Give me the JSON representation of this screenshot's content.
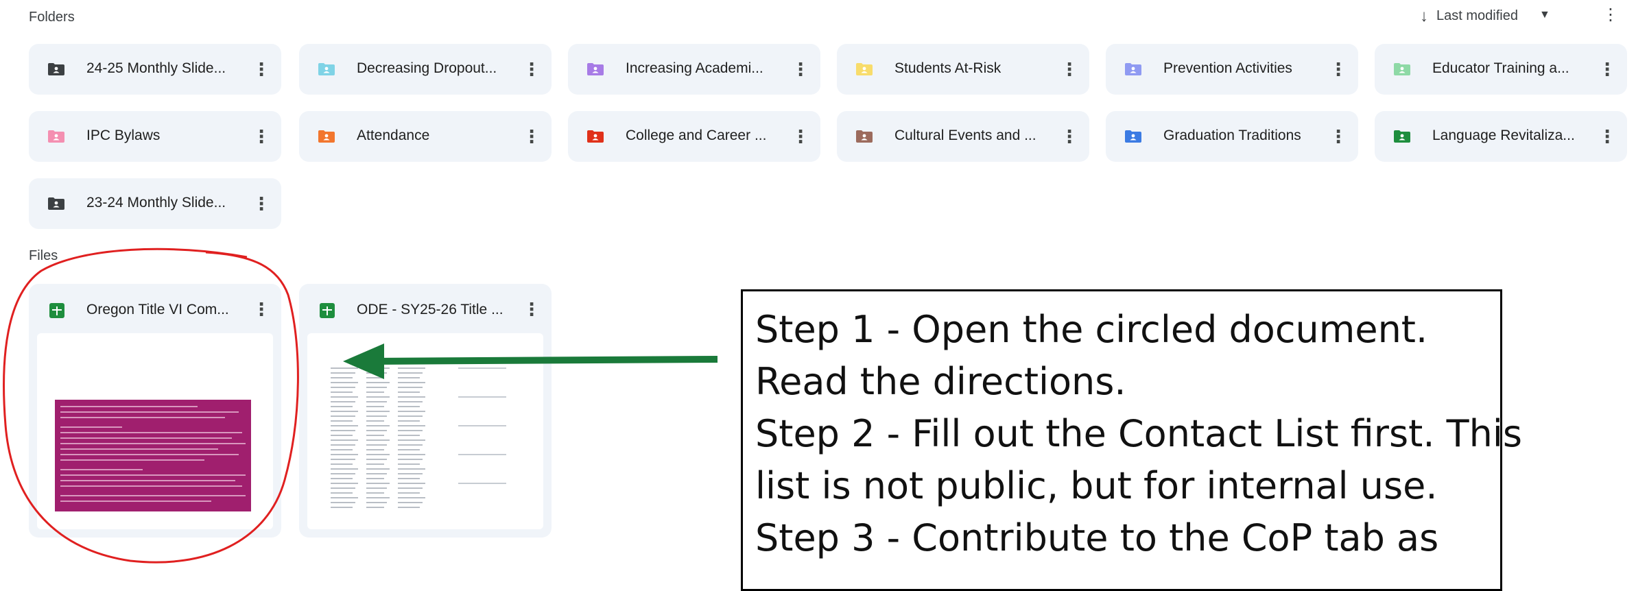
{
  "sections": {
    "folders": "Folders",
    "files": "Files"
  },
  "sort": {
    "label": "Last modified"
  },
  "folders": [
    {
      "name": "24-25 Monthly Slide...",
      "color": "#3c4043"
    },
    {
      "name": "Decreasing Dropout...",
      "color": "#7fd3e6"
    },
    {
      "name": "Increasing Academi...",
      "color": "#a77be6"
    },
    {
      "name": "Students At-Risk",
      "color": "#f8dc6b"
    },
    {
      "name": "Prevention Activities",
      "color": "#8f9af2"
    },
    {
      "name": "Educator Training a...",
      "color": "#8ed9a6"
    },
    {
      "name": "IPC Bylaws",
      "color": "#f48fb1"
    },
    {
      "name": "Attendance",
      "color": "#f2762e"
    },
    {
      "name": "College and Career ...",
      "color": "#e0311a"
    },
    {
      "name": "Cultural Events and ...",
      "color": "#9c6b5d"
    },
    {
      "name": "Graduation Traditions",
      "color": "#3b7be3"
    },
    {
      "name": "Language Revitaliza...",
      "color": "#1e8e3e"
    },
    {
      "name": "23-24 Monthly Slide...",
      "color": "#3c4043"
    }
  ],
  "files": [
    {
      "name": "Oregon Title VI Com...",
      "icon": "google-sheets-icon"
    },
    {
      "name": "ODE - SY25-26 Title ...",
      "icon": "google-sheets-icon"
    }
  ],
  "callout": {
    "lines": [
      "Step 1 - Open the circled document.",
      "Read the directions.",
      "Step 2 - Fill out the Contact List first. This",
      "list is not public, but for internal use.",
      "Step 3 - Contribute to the CoP tab as"
    ]
  },
  "colors": {
    "annotation_circle": "#e02020",
    "annotation_arrow": "#1a7a3a",
    "chip_bg": "#f0f4f9",
    "thumb_magenta": "#a01f6e"
  }
}
